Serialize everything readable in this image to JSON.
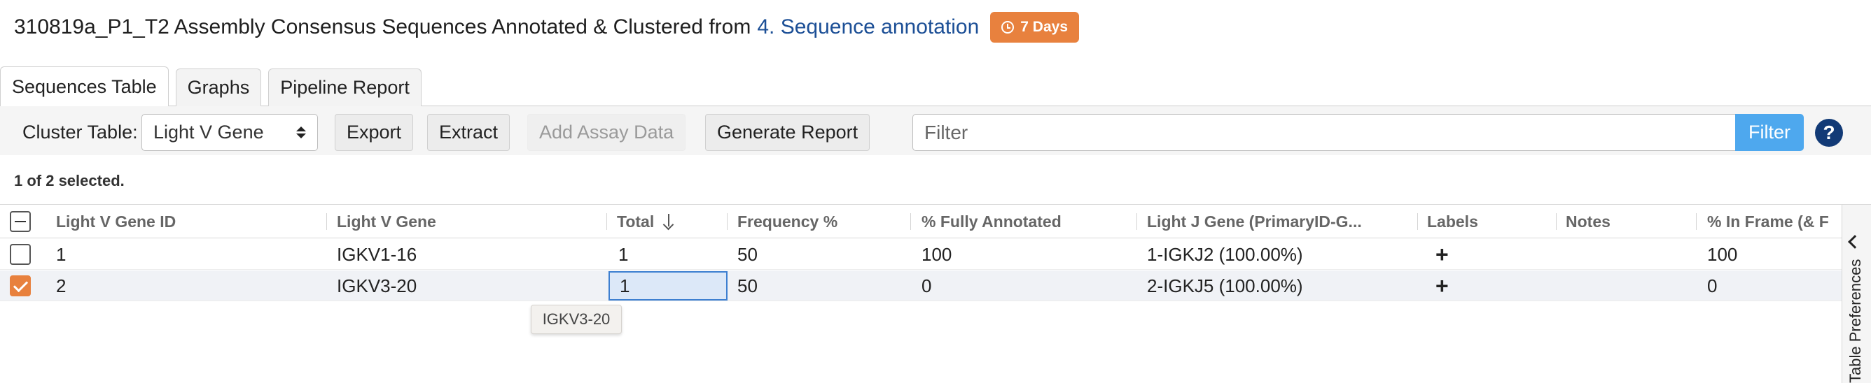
{
  "header": {
    "title": "310819a_P1_T2 Assembly Consensus Sequences Annotated & Clustered from",
    "link": "4. Sequence annotation",
    "badge": "7 Days"
  },
  "tabs": [
    {
      "label": "Sequences Table",
      "active": true
    },
    {
      "label": "Graphs",
      "active": false
    },
    {
      "label": "Pipeline Report",
      "active": false
    }
  ],
  "toolbar": {
    "cluster_label": "Cluster Table:",
    "cluster_select": "Light V Gene",
    "export": "Export",
    "extract": "Extract",
    "add_assay": "Add Assay Data",
    "generate_report": "Generate Report",
    "filter_placeholder": "Filter",
    "filter_button": "Filter",
    "help": "?"
  },
  "selection_info": "1 of 2 selected.",
  "table": {
    "columns": [
      "Light V Gene ID",
      "Light V Gene",
      "Total",
      "Frequency %",
      "% Fully Annotated",
      "Light J Gene (PrimaryID-G...",
      "Labels",
      "Notes",
      "% In Frame (& F"
    ],
    "sorted_column": "Total",
    "sort_direction": "descending",
    "rows": [
      {
        "selected": false,
        "cells": [
          "1",
          "IGKV1-16",
          "1",
          "50",
          "100",
          "1-IGKJ2 (100.00%)",
          "+",
          "",
          "100"
        ]
      },
      {
        "selected": true,
        "cells": [
          "2",
          "IGKV3-20",
          "1",
          "50",
          "0",
          "2-IGKJ5 (100.00%)",
          "+",
          "",
          "0"
        ]
      }
    ]
  },
  "tooltip": "IGKV3-20",
  "side_panel": "Table Preferences",
  "colors": {
    "accent_orange": "#e8813e",
    "link_blue": "#1c4f96",
    "filter_blue": "#4ea8ee",
    "help_navy": "#123a76"
  }
}
